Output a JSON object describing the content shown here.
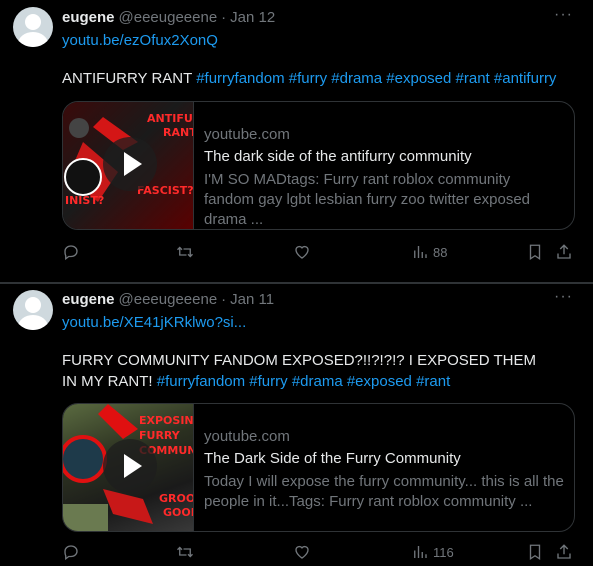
{
  "tweets": [
    {
      "author": "eugene",
      "handle": "@eeeugeeene",
      "sep": "·",
      "date": "Jan 12",
      "link": "youtu.be/ezOfux2XonQ",
      "text": "ANTIFURRY RANT",
      "tags": [
        "#furryfandom",
        "#furry",
        "#drama",
        "#exposed",
        "#rant",
        "#antifurry"
      ],
      "card": {
        "domain": "youtube.com",
        "title": "The dark side of the antifurry community",
        "desc": "I'M SO MADtags: Furry rant roblox community fandom gay lgbt lesbian furry zoo twitter exposed drama ...",
        "thumb_text": [
          "ANTIFU",
          "RANT",
          "FASCIST?",
          "INIST?"
        ]
      },
      "views": "88"
    },
    {
      "author": "eugene",
      "handle": "@eeeugeeene",
      "sep": "·",
      "date": "Jan 11",
      "link": "youtu.be/XE41jKRklwo?si...",
      "text": "FURRY COMMUNITY FANDOM EXPOSED?!!?!?!? I EXPOSED THEM IN MY RANT!",
      "tags": [
        "#furryfandom",
        "#furry",
        "#drama",
        "#exposed",
        "#rant"
      ],
      "card": {
        "domain": "youtube.com",
        "title": "The Dark Side of the Furry Community",
        "desc": "Today I will expose the furry community... this is all the people in it...Tags: Furry rant roblox community ...",
        "thumb_text": [
          "EXPOSING",
          "FURRY",
          "COMMUN",
          "GROO",
          "GOON"
        ]
      },
      "views": "116"
    }
  ],
  "more_glyph": "···",
  "colors": {
    "link": "#1d9bf0",
    "muted": "#71767b",
    "text": "#e7e9ea",
    "border": "#2f3336",
    "thumb_red": "#ff2a2a"
  },
  "icons": [
    "reply-icon",
    "retweet-icon",
    "like-icon",
    "views-icon",
    "bookmark-icon",
    "share-icon"
  ]
}
